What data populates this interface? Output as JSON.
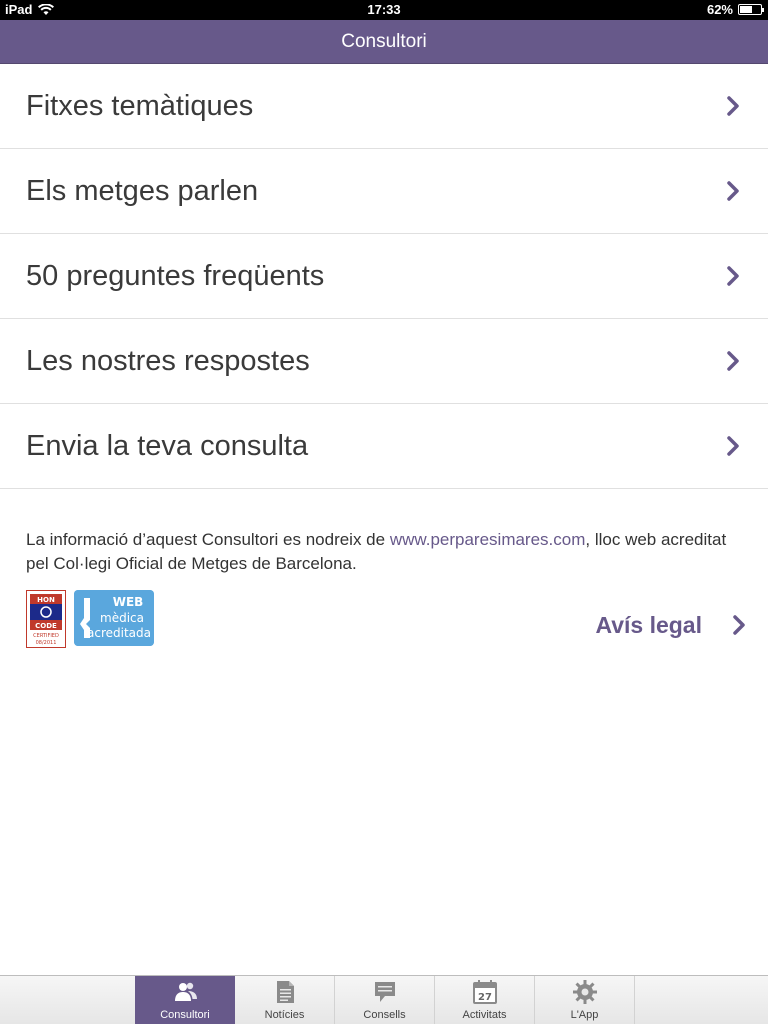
{
  "status_bar": {
    "device": "iPad",
    "time": "17:33",
    "battery": "62%",
    "battery_level": 0.62
  },
  "nav": {
    "title": "Consultori"
  },
  "menu": [
    {
      "label": "Fitxes temàtiques"
    },
    {
      "label": "Els metges parlen"
    },
    {
      "label": "50 preguntes freqüents"
    },
    {
      "label": "Les nostres respostes"
    },
    {
      "label": "Envia la teva consulta"
    }
  ],
  "info": {
    "text_before": "La informació d’aquest Consultori es nodreix de ",
    "link": "www.perparesimares.com",
    "text_after": ", lloc web acreditat pel Col·legi Oficial de Metges de Barcelona."
  },
  "badges": {
    "hon": {
      "line1": "HON",
      "line2": "CODE",
      "line3": "CERTIFIED",
      "line4": "08/2011"
    },
    "web": {
      "line1": "WEB",
      "line2": "mèdica",
      "line3": "acreditada"
    }
  },
  "legal": {
    "label": "Avís legal"
  },
  "tabbar": {
    "tabs": [
      {
        "label": "Consultori",
        "icon": "people-icon",
        "active": true
      },
      {
        "label": "Notícies",
        "icon": "document-icon",
        "active": false
      },
      {
        "label": "Consells",
        "icon": "speech-bubble-icon",
        "active": false
      },
      {
        "label": "Activitats",
        "icon": "calendar-icon",
        "active": false,
        "badge": "27"
      },
      {
        "label": "L'App",
        "icon": "gear-icon",
        "active": false
      }
    ]
  },
  "colors": {
    "accent": "#67598a",
    "text": "#3a3a3a",
    "divider": "#e0e0e0"
  }
}
